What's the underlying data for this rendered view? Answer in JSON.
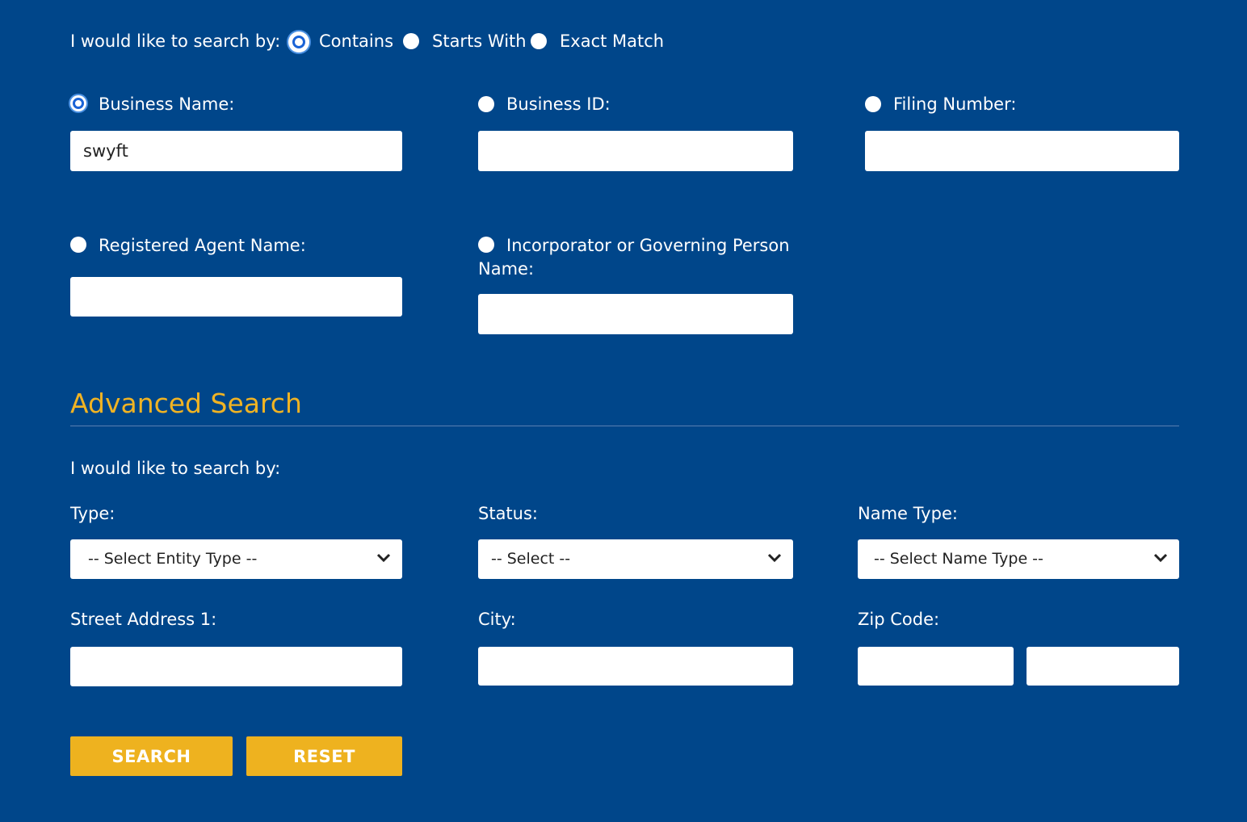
{
  "search_mode": {
    "label": "I would like to search by:",
    "options": [
      {
        "label": "Contains",
        "selected": true
      },
      {
        "label": "Starts With",
        "selected": false
      },
      {
        "label": "Exact Match",
        "selected": false
      }
    ]
  },
  "fields": {
    "business_name": {
      "label": "Business Name:",
      "value": "swyft",
      "selected": true
    },
    "business_id": {
      "label": "Business ID:",
      "value": "",
      "selected": false
    },
    "filing_number": {
      "label": "Filing Number:",
      "value": "",
      "selected": false
    },
    "registered_agent": {
      "label": "Registered Agent Name:",
      "value": "",
      "selected": false
    },
    "incorporator_line1": "Incorporator or Governing Person",
    "incorporator_line2": "Name:",
    "incorporator_value": ""
  },
  "advanced": {
    "title": "Advanced Search",
    "search_by_label": "I would like to search by:",
    "type": {
      "label": "Type:",
      "selected": "-- Select Entity Type --"
    },
    "status": {
      "label": "Status:",
      "selected": "-- Select --"
    },
    "name_type": {
      "label": "Name Type:",
      "selected": "-- Select Name Type --"
    },
    "street": {
      "label": "Street Address 1:",
      "value": ""
    },
    "city": {
      "label": "City:",
      "value": ""
    },
    "zip": {
      "label": "Zip Code:",
      "value": "",
      "value_ext": ""
    }
  },
  "buttons": {
    "search": "SEARCH",
    "reset": "RESET"
  },
  "colors": {
    "background": "#00468a",
    "accent": "#eeb21f",
    "heading": "#f0b323",
    "radio_selected": "#1a63d6"
  }
}
